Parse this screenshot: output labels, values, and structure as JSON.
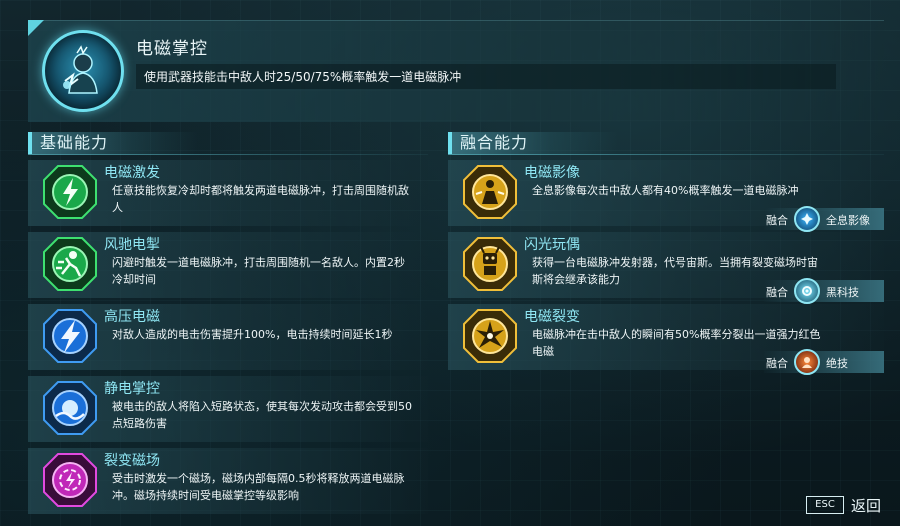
{
  "header": {
    "title": "电磁掌控",
    "description": "使用武器技能击中敌人时25/50/75%概率触发一道电磁脉冲",
    "icon": "electro-mastery-icon"
  },
  "sections": {
    "basic": "基础能力",
    "fusion": "融合能力"
  },
  "basic_abilities": [
    {
      "name": "电磁激发",
      "description": "任意技能恢复冷却时都将触发两道电磁脉冲，打击周围随机敌人",
      "icon": "lightning-bolt-icon",
      "color": "#1aa84a"
    },
    {
      "name": "风驰电掣",
      "description": "闪避时触发一道电磁脉冲，打击周围随机一名敌人。内置2秒冷却时间",
      "icon": "dash-figure-icon",
      "color": "#1aa84a"
    },
    {
      "name": "高压电磁",
      "description": "对敌人造成的电击伤害提升100%，电击持续时间延长1秒",
      "icon": "high-voltage-icon",
      "color": "#1a6fd8"
    },
    {
      "name": "静电掌控",
      "description": "被电击的敌人将陷入短路状态，使其每次发动攻击都会受到50点短路伤害",
      "icon": "static-orb-icon",
      "color": "#1a6fd8"
    },
    {
      "name": "裂变磁场",
      "description": "受击时激发一个磁场，磁场内部每隔0.5秒将释放两道电磁脉冲。磁场持续时间受电磁掌控等级影响",
      "icon": "magnetic-field-icon",
      "color": "#c028b8"
    }
  ],
  "fusion_abilities": [
    {
      "name": "电磁影像",
      "description": "全息影像每次击中敌人都有40%概率触发一道电磁脉冲",
      "icon": "hologram-figure-icon",
      "color": "#d6a21a",
      "fusion_label": "融合",
      "fusion_with": "全息影像",
      "fusion_icon": "hologram-icon"
    },
    {
      "name": "闪光玩偶",
      "description": "获得一台电磁脉冲发射器，代号宙斯。当拥有裂变磁场时宙斯将会继承该能力",
      "icon": "robot-doll-icon",
      "color": "#d6a21a",
      "fusion_label": "融合",
      "fusion_with": "黑科技",
      "fusion_icon": "tech-gear-icon"
    },
    {
      "name": "电磁裂变",
      "description": "电磁脉冲在击中敌人的瞬间有50%概率分裂出一道强力红色电磁",
      "icon": "fission-burst-icon",
      "color": "#d6a21a",
      "fusion_label": "融合",
      "fusion_with": "绝技",
      "fusion_icon": "ultimate-icon"
    }
  ],
  "footer": {
    "esc_key": "ESC",
    "back_label": "返回"
  }
}
